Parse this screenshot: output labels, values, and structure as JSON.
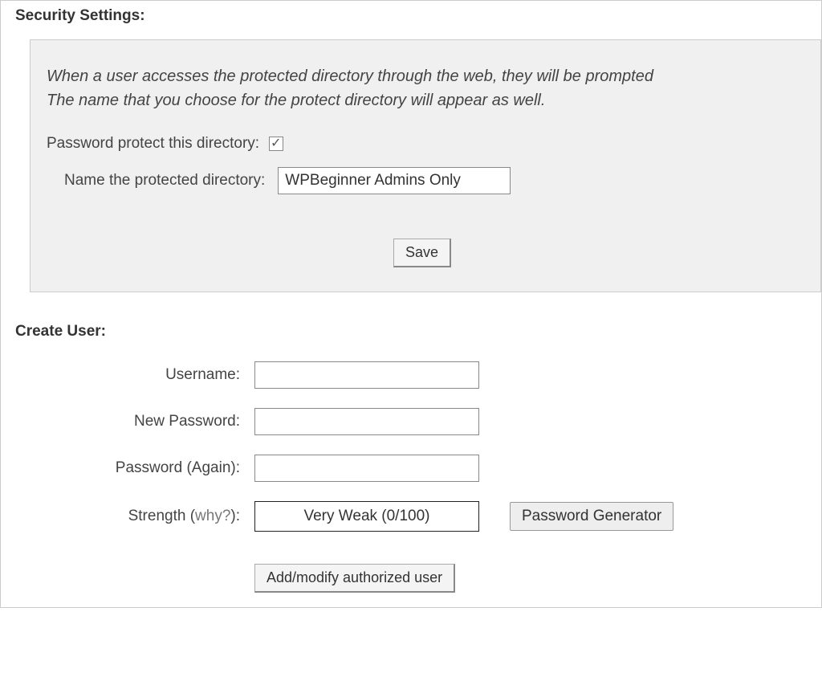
{
  "security": {
    "title": "Security Settings:",
    "description_line1": "When a user accesses the protected directory through the web, they will be prompted",
    "description_line2": "The name that you choose for the protect directory will appear as well.",
    "protect_label": "Password protect this directory:",
    "protect_checked": true,
    "dirname_label": "Name the protected directory:",
    "dirname_value": "WPBeginner Admins Only",
    "save_label": "Save"
  },
  "create_user": {
    "title": "Create User:",
    "username_label": "Username:",
    "username_value": "",
    "newpass_label": "New Password:",
    "newpass_value": "",
    "again_label": "Password (Again):",
    "again_value": "",
    "strength_label_prefix": "Strength (",
    "strength_label_why": "why?",
    "strength_label_suffix": "):",
    "strength_value": "Very Weak (0/100)",
    "pwgen_label": "Password Generator",
    "add_user_label": "Add/modify authorized user"
  }
}
